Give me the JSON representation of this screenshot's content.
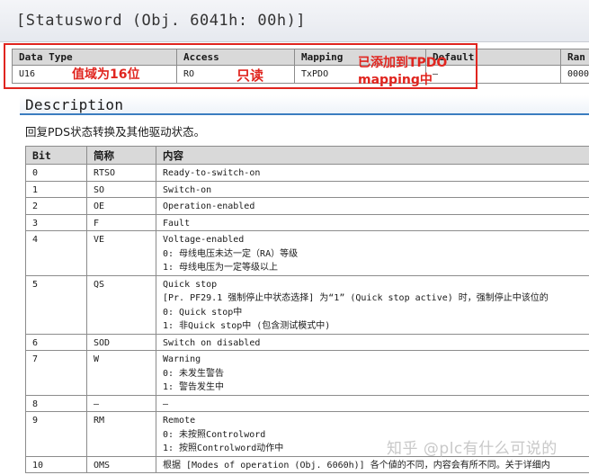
{
  "title": "[Statusword (Obj. 6041h: 00h)]",
  "summary": {
    "headers": [
      "Data Type",
      "Access",
      "Mapping",
      "Default",
      "Ran"
    ],
    "row": [
      "U16",
      "RO",
      "TxPDO",
      "—",
      "0000"
    ]
  },
  "annotations": {
    "data_type_note": "值域为16位",
    "access_note": "只读",
    "mapping_note_line1": "已添加到TPDO",
    "mapping_note_line2": "mapping中",
    "color": "#e0251f"
  },
  "description": {
    "heading": "Description",
    "text": "回复PDS状态转换及其他驱动状态。"
  },
  "bit_table": {
    "headers": [
      "Bit",
      "简称",
      "内容"
    ],
    "rows": [
      {
        "bit": "0",
        "abbr": "RTSO",
        "lines": [
          "Ready-to-switch-on"
        ]
      },
      {
        "bit": "1",
        "abbr": "SO",
        "lines": [
          "Switch-on"
        ]
      },
      {
        "bit": "2",
        "abbr": "OE",
        "lines": [
          "Operation-enabled"
        ]
      },
      {
        "bit": "3",
        "abbr": "F",
        "lines": [
          "Fault"
        ]
      },
      {
        "bit": "4",
        "abbr": "VE",
        "lines": [
          "Voltage-enabled",
          "0: 母线电压未达一定（RA）等级",
          "1: 母线电压为一定等级以上"
        ]
      },
      {
        "bit": "5",
        "abbr": "QS",
        "lines": [
          "Quick stop",
          "[Pr. PF29.1 强制停止中状态选择] 为“1” (Quick stop active) 时，强制停止中该位的",
          "0: Quick stop中",
          "1: 非Quick stop中 (包含测试模式中)"
        ]
      },
      {
        "bit": "6",
        "abbr": "SOD",
        "lines": [
          "Switch on disabled"
        ]
      },
      {
        "bit": "7",
        "abbr": "W",
        "lines": [
          "Warning",
          "0: 未发生警告",
          "1: 警告发生中"
        ]
      },
      {
        "bit": "8",
        "abbr": "—",
        "lines": [
          "—"
        ]
      },
      {
        "bit": "9",
        "abbr": "RM",
        "lines": [
          "Remote",
          "0: 未按照Controlword",
          "1: 按照Controlword动作中"
        ]
      },
      {
        "bit": "10",
        "abbr": "OMS",
        "lines": [
          "根据 [Modes of operation (Obj. 6060h)] 各个値的不同，内容会有所不同。关于详细内"
        ]
      }
    ]
  },
  "watermark": "知乎 @plc有什么可说的"
}
